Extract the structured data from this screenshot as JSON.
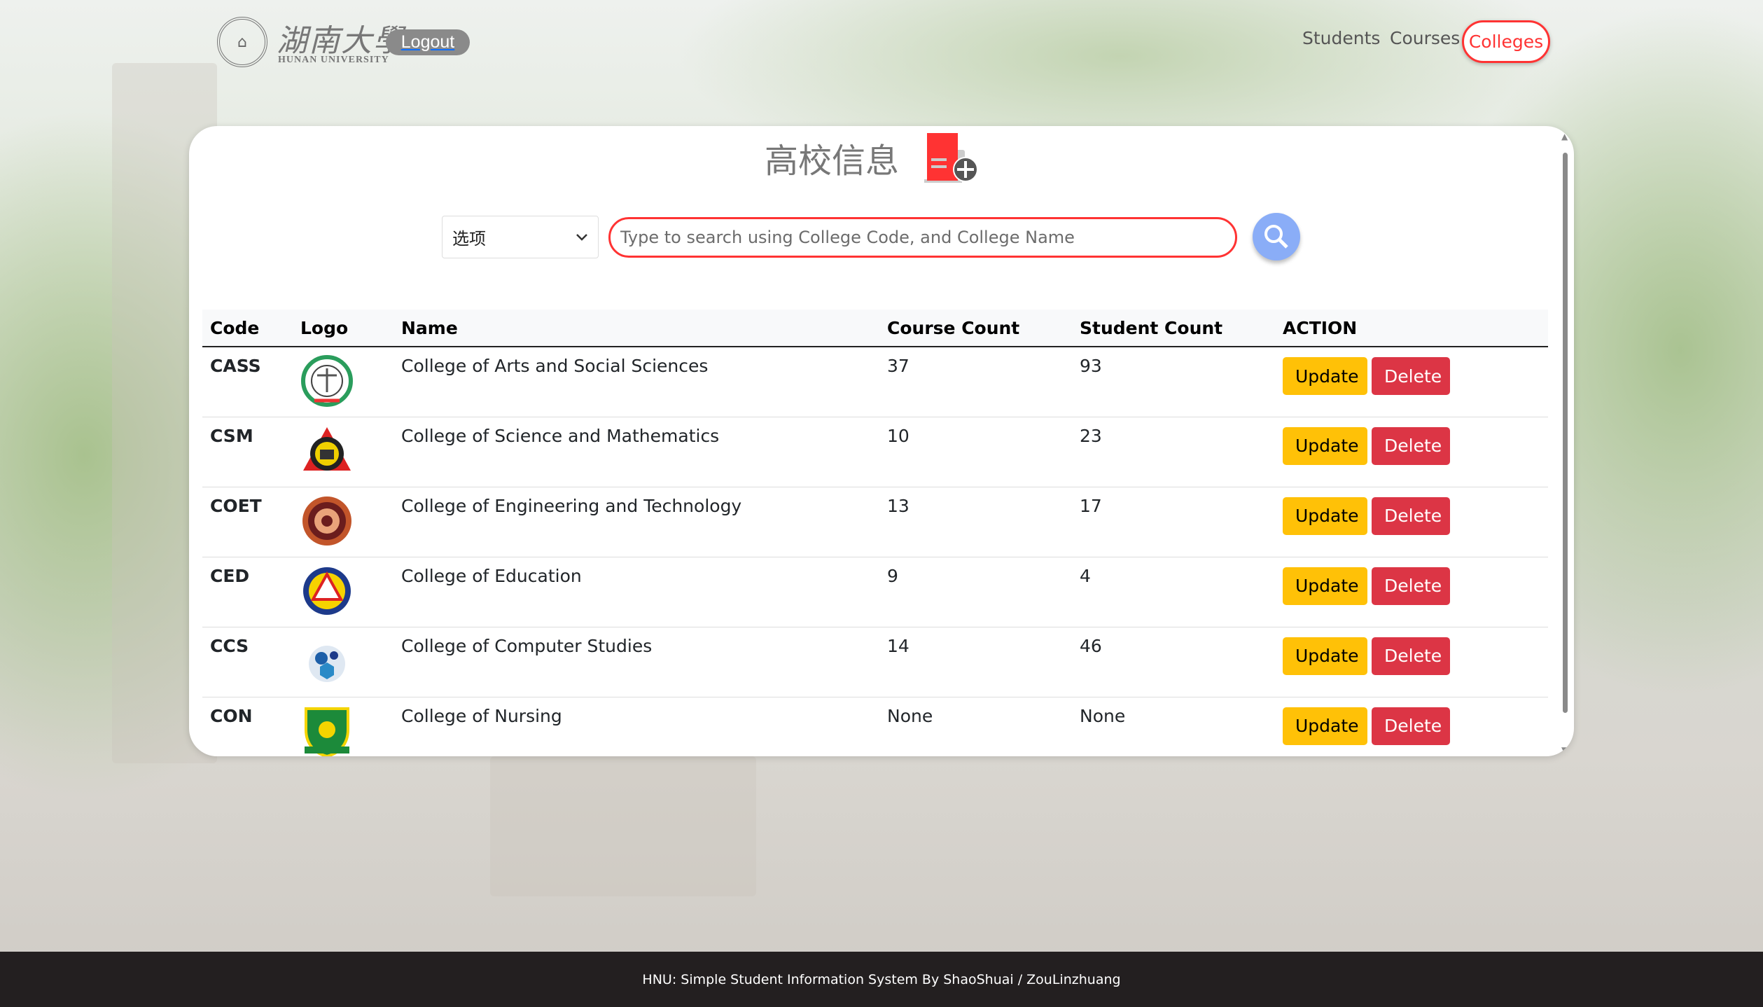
{
  "header": {
    "brand_cn": "湖南大學",
    "brand_en": "HUNAN UNIVERSITY",
    "logout_label": "Logout",
    "nav": [
      {
        "label": "Students",
        "active": false
      },
      {
        "label": "Courses",
        "active": false
      },
      {
        "label": "Colleges",
        "active": true
      }
    ]
  },
  "main": {
    "title": "高校信息",
    "add_icon": "add-document-icon",
    "select_value": "选项",
    "search_placeholder": "Type to search using College Code, and College Name",
    "search_icon": "magnifier-icon",
    "columns": [
      "Code",
      "Logo",
      "Name",
      "Course Count",
      "Student Count",
      "ACTION"
    ],
    "rows": [
      {
        "code": "CASS",
        "name": "College of Arts and Social Sciences",
        "course_count": "37",
        "student_count": "93"
      },
      {
        "code": "CSM",
        "name": "College of Science and Mathematics",
        "course_count": "10",
        "student_count": "23"
      },
      {
        "code": "COET",
        "name": "College of Engineering and Technology",
        "course_count": "13",
        "student_count": "17"
      },
      {
        "code": "CED",
        "name": "College of Education",
        "course_count": "9",
        "student_count": "4"
      },
      {
        "code": "CCS",
        "name": "College of Computer Studies",
        "course_count": "14",
        "student_count": "46"
      },
      {
        "code": "CON",
        "name": "College of Nursing",
        "course_count": "None",
        "student_count": "None"
      }
    ],
    "update_label": "Update",
    "delete_label": "Delete"
  },
  "footer": {
    "text": "HNU: Simple Student Information System By ShaoShuai / ZouLinzhuang"
  },
  "colors": {
    "accent": "#ff3333",
    "update": "#ffc107",
    "delete": "#dc3545",
    "search_button": "#8aadf7",
    "footer": "#231f20"
  }
}
